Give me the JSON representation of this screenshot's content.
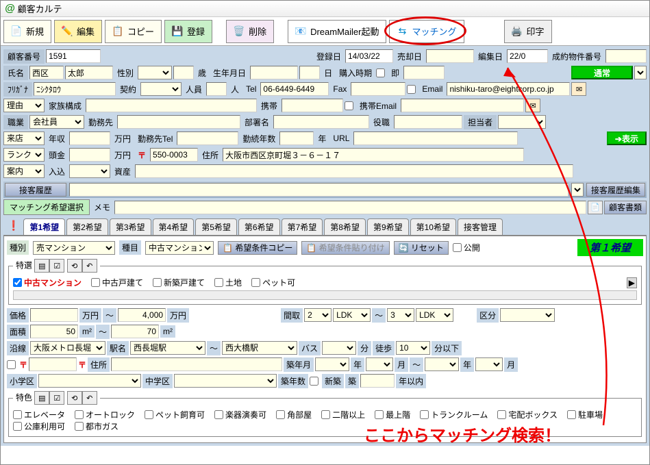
{
  "window": {
    "title": "顧客カルテ"
  },
  "toolbar": {
    "new": "新規",
    "edit": "編集",
    "copy": "コピー",
    "register": "登録",
    "delete": "削除",
    "dreammailer": "DreamMailer起動",
    "matching": "マッチング",
    "print": "印字"
  },
  "customer": {
    "id_label": "顧客番号",
    "id": "1591",
    "reg_date_label": "登録日",
    "reg_date": "14/03/22",
    "sale_date_label": "売却日",
    "sale_date": "",
    "edit_date_label": "編集日",
    "edit_date": "22/0",
    "contract_prop_label": "成約物件番号",
    "name_label": "氏名",
    "name_sur": "西区",
    "name_given": "太郎",
    "sex_label": "性別",
    "age_label": "歳",
    "bday_label": "生年月日",
    "purchase_time_label": "購入時期",
    "instant_label": "即",
    "status": "通常",
    "kana_label": "ﾌﾘｶﾞﾅ",
    "kana": "ﾆｼｸﾀﾛｳ",
    "contract_label": "契約",
    "headcount_label": "人員",
    "headcount_unit": "人",
    "tel_label": "Tel",
    "tel": "06-6449-6449",
    "fax_label": "Fax",
    "email_label": "Email",
    "email": "nishiku-taro@eightcorp.co.jp",
    "reason_label": "理由",
    "family_label": "家族構成",
    "mobile_label": "携帯",
    "mobile_email_label": "携帯Email",
    "occ_label": "職業",
    "occ": "会社員",
    "workplace_label": "勤務先",
    "dept_label": "部署名",
    "role_label": "役職",
    "rep_label": "担当者",
    "visit_label": "来店",
    "income_label": "年収",
    "man_unit": "万円",
    "work_tel_label": "勤務先Tel",
    "work_years_label": "勤続年数",
    "year_unit": "年",
    "url_label": "URL",
    "rank_label": "ランク",
    "deposit_label": "頭金",
    "post_label": "〒",
    "post": "550-0003",
    "address_label": "住所",
    "address": "大阪市西区京町堀３－６－１７",
    "guide_label": "案内",
    "inflow_label": "入込",
    "asset_label": "資産",
    "show_btn": "表示"
  },
  "history": {
    "heading": "接客履歴",
    "edit_btn": "接客履歴編集",
    "match_sel_btn": "マッチング希望選択",
    "memo_label": "メモ",
    "docs_btn": "顧客書類"
  },
  "tabs": {
    "t1": "第1希望",
    "t2": "第2希望",
    "t3": "第3希望",
    "t4": "第4希望",
    "t5": "第5希望",
    "t6": "第6希望",
    "t7": "第7希望",
    "t8": "第8希望",
    "t9": "第9希望",
    "t10": "第10希望",
    "t_mgmt": "接客管理"
  },
  "wish": {
    "kind_label": "種別",
    "kind": "売マンション",
    "type_label": "種目",
    "type": "中古マンション",
    "copy_cond": "希望条件コピー",
    "paste_cond": "希望条件貼り付け",
    "reset": "リセット",
    "public": "公開",
    "title": "第１希望",
    "tokusen_label": "特選",
    "cb_used_mansion": "中古マンション",
    "cb_used_house": "中古戸建て",
    "cb_new_house": "新築戸建て",
    "cb_land": "土地",
    "cb_pet": "ペット可",
    "price_label": "価格",
    "price_to": "4,000",
    "price_unit": "万円",
    "tilde": "～",
    "layout_label": "間取",
    "layout_from": "2",
    "layout_from_type": "LDK",
    "layout_to": "3",
    "layout_to_type": "LDK",
    "section_label": "区分",
    "area_label": "面積",
    "area_from": "50",
    "area_to": "70",
    "area_unit": "m²",
    "line_label": "沿線",
    "line": "大阪メトロ長堀",
    "station_label": "駅名",
    "station_from": "西長堀駅",
    "station_to": "西大橋駅",
    "bus_label": "バス",
    "bus_unit": "分",
    "walk_label": "徒歩",
    "walk": "10",
    "walk_unit": "分以下",
    "addr_sub_label": "住所",
    "built_ym_label": "築年月",
    "y_unit": "年",
    "m_unit": "月",
    "elem_label": "小学区",
    "jhs_label": "中学区",
    "built_yrs_label": "築年数",
    "new_label": "新築",
    "yrs_label": "築",
    "within": "年以内",
    "feature_label": "特色",
    "f_elev": "エレベータ",
    "f_autolock": "オートロック",
    "f_pet": "ペット飼育可",
    "f_music": "楽器演奏可",
    "f_corner": "角部屋",
    "f_2f": "二階以上",
    "f_top": "最上階",
    "f_trunk": "トランクルーム",
    "f_delivery": "宅配ボックス",
    "f_parking": "駐車場",
    "f_public": "公庫利用可",
    "f_gas": "都市ガス"
  },
  "annotation": "ここからマッチング検索！"
}
